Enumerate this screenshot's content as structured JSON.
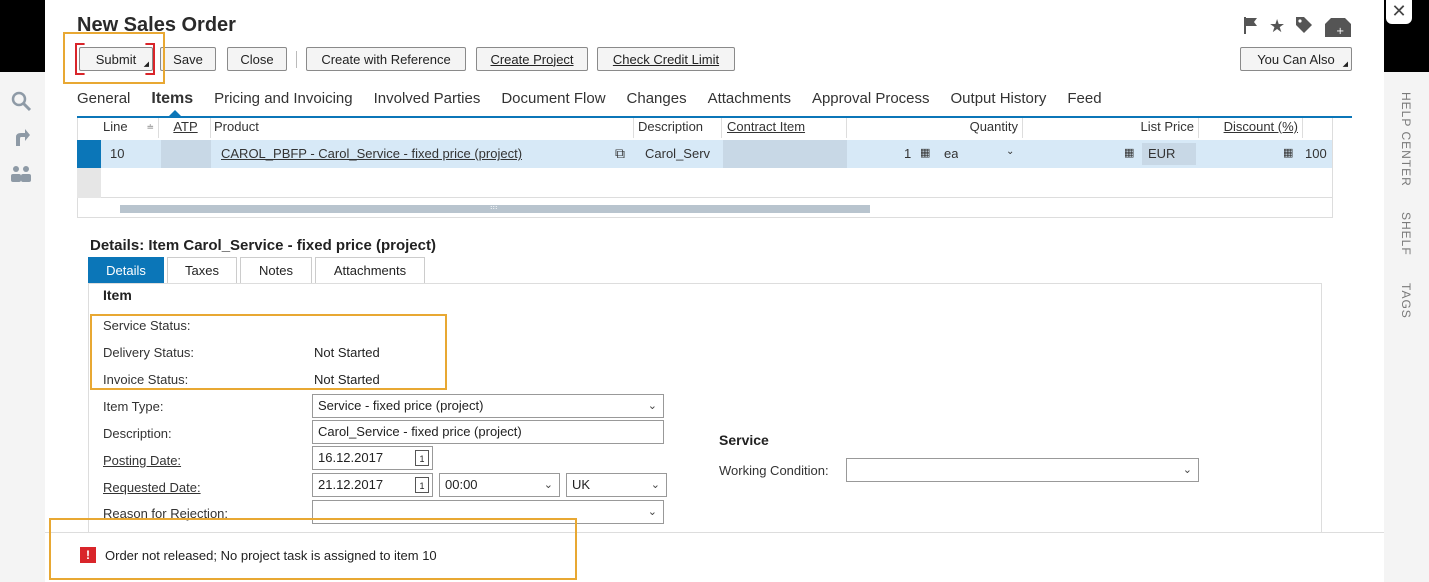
{
  "window": {
    "close_glyph": "✕"
  },
  "page": {
    "title": "New Sales Order"
  },
  "toolbar": {
    "submit": "Submit",
    "save": "Save",
    "close": "Close",
    "create_with_reference": "Create with Reference",
    "create_project": "Create Project",
    "check_credit_limit": "Check Credit Limit",
    "you_can_also": "You Can Also"
  },
  "top_icons": [
    "flag-icon",
    "star-icon",
    "tag-icon",
    "new-window-icon"
  ],
  "tabs": [
    "General",
    "Items",
    "Pricing and Invoicing",
    "Involved Parties",
    "Document Flow",
    "Changes",
    "Attachments",
    "Approval Process",
    "Output History",
    "Feed"
  ],
  "active_tab": "Items",
  "grid": {
    "columns": {
      "line": "Line",
      "atp": "ATP",
      "product": "Product",
      "description": "Description",
      "contract_item": "Contract Item",
      "quantity": "Quantity",
      "list_price": "List Price",
      "discount": "Discount (%)"
    },
    "rows": [
      {
        "line": "10",
        "product": "CAROL_PBFP - Carol_Service - fixed price (project)",
        "description": "Carol_Serv",
        "quantity": "1",
        "unit": "ea",
        "currency": "EUR",
        "discount": "100"
      }
    ]
  },
  "details": {
    "title": "Details: Item Carol_Service - fixed price (project)",
    "subtabs": [
      "Details",
      "Taxes",
      "Notes",
      "Attachments"
    ],
    "item_section": "Item",
    "service_status_label": "Service Status:",
    "delivery_status_label": "Delivery Status:",
    "delivery_status_value": "Not Started",
    "invoice_status_label": "Invoice Status:",
    "invoice_status_value": "Not Started",
    "item_type_label": "Item Type:",
    "item_type_value": "Service - fixed price (project)",
    "description_label": "Description:",
    "description_value": "Carol_Service - fixed price (project)",
    "posting_date_label": "Posting Date:",
    "posting_date_value": "16.12.2017",
    "requested_date_label": "Requested Date:",
    "requested_date_value": "21.12.2017",
    "requested_time_value": "00:00",
    "requested_tz_value": "UK",
    "reason_label": "Reason for Rejection:",
    "service_section": "Service",
    "working_condition_label": "Working Condition:"
  },
  "message": {
    "text": "Order not released; No project task is assigned to item 10",
    "severity": "error"
  },
  "right_rail": [
    "HELP CENTER",
    "SHELF",
    "TAGS"
  ],
  "left_rail": [
    "search-icon",
    "share-icon",
    "people-icon"
  ],
  "colors": {
    "accent": "#0b76b8",
    "highlight": "#e8a833",
    "error": "#d9252a",
    "selected_row": "#d7e9f7"
  }
}
